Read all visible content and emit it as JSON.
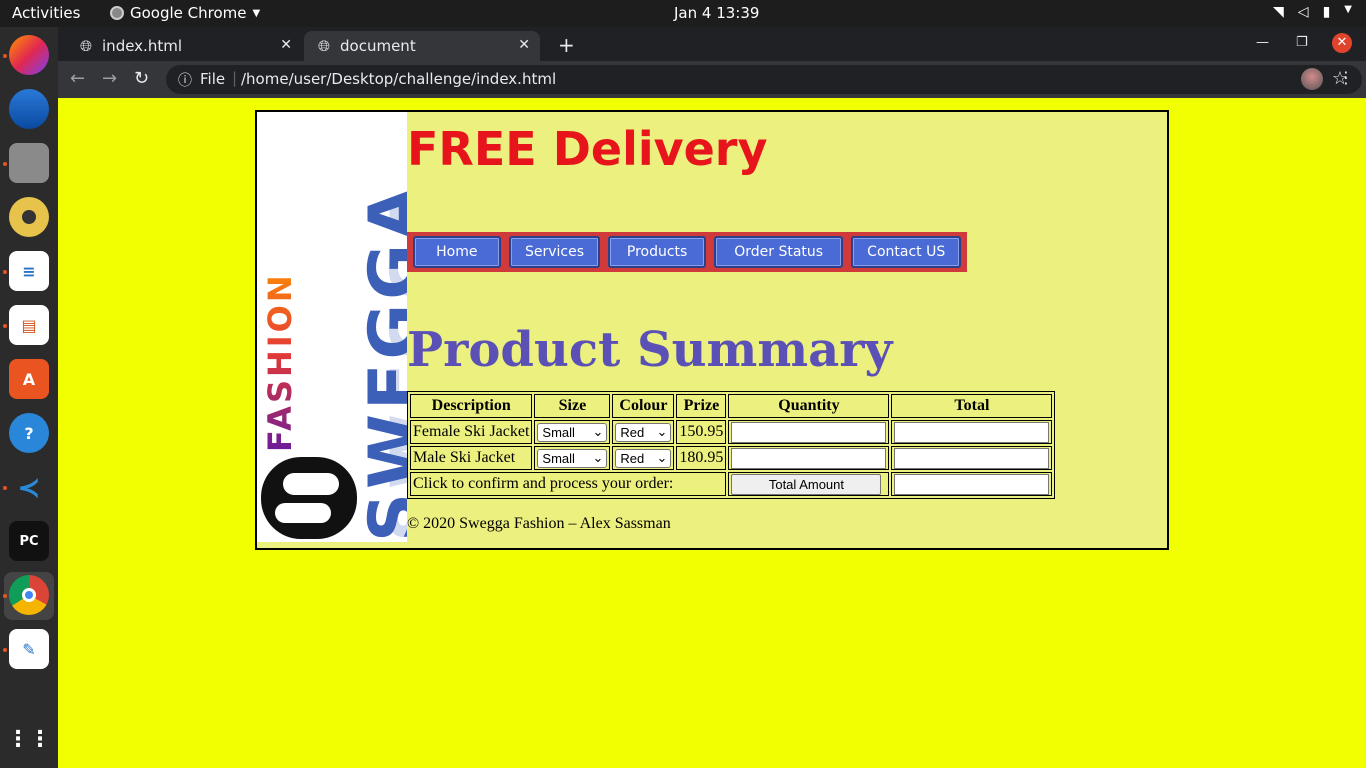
{
  "topbar": {
    "activities": "Activities",
    "app_name": "Google Chrome",
    "clock": "Jan 4  13:39"
  },
  "dock": {
    "items": [
      "Firefox",
      "Thunderbird",
      "Files",
      "Rhythmbox",
      "LibreOffice Writer",
      "LibreOffice Impress",
      "Ubuntu Software",
      "Help",
      "Visual Studio Code",
      "PyCharm",
      "Google Chrome",
      "Text Editor",
      "Show Applications"
    ]
  },
  "browser": {
    "tabs": [
      {
        "label": "index.html",
        "active": false
      },
      {
        "label": "document",
        "active": true
      }
    ],
    "omnibox": {
      "scheme": "File",
      "url": "/home/user/Desktop/challenge/index.html"
    }
  },
  "page": {
    "logo_text": "SWEGGA",
    "logo_subtext": "FASHION",
    "headline": "FREE Delivery",
    "nav": [
      "Home",
      "Services",
      "Products",
      "Order Status",
      "Contact US"
    ],
    "title": "Product Summary",
    "table": {
      "headers": [
        "Description",
        "Size",
        "Colour",
        "Prize",
        "Quantity",
        "Total"
      ],
      "rows": [
        {
          "description": "Female Ski Jacket",
          "size": "Small",
          "colour": "Red",
          "prize": "150.95",
          "quantity": "",
          "total": ""
        },
        {
          "description": "Male Ski Jacket",
          "size": "Small",
          "colour": "Red",
          "prize": "180.95",
          "quantity": "",
          "total": ""
        }
      ],
      "confirm_label": "Click to confirm and process your order:",
      "total_button": "Total Amount",
      "total_value": ""
    },
    "footer": "© 2020 Swegga Fashion – Alex Sassman",
    "colors": {
      "background": "#f2ff00",
      "panel": "#ecf07e",
      "headline": "#e8141c",
      "title": "#5a50b5",
      "nav_bar": "#d03a3a",
      "nav_button": "#4a6bd6"
    }
  }
}
